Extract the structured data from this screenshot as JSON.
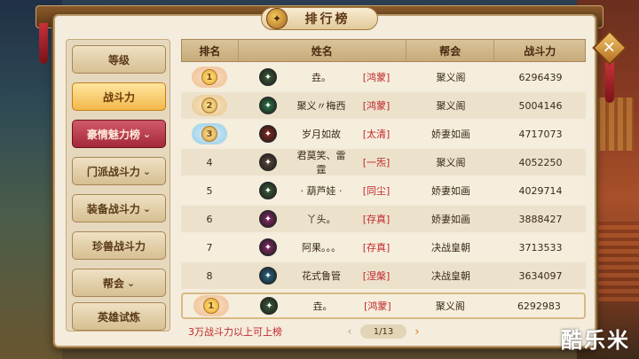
{
  "window": {
    "title": "排行榜"
  },
  "close": {
    "glyph": "✕"
  },
  "sidebar": {
    "items": [
      {
        "label": "等级",
        "chevron": ""
      },
      {
        "label": "战斗力",
        "chevron": ""
      },
      {
        "label": "豪情魅力榜",
        "chevron": "⌄"
      },
      {
        "label": "门派战斗力",
        "chevron": "⌄"
      },
      {
        "label": "装备战斗力",
        "chevron": "⌄"
      },
      {
        "label": "珍兽战斗力",
        "chevron": ""
      },
      {
        "label": "帮会",
        "chevron": "⌄"
      },
      {
        "label": "英雄试炼",
        "chevron": ""
      }
    ]
  },
  "table": {
    "headers": {
      "rank": "排名",
      "name": "姓名",
      "guild": "帮会",
      "power": "战斗力"
    },
    "rows": [
      {
        "rank": "1",
        "medal": "gold",
        "icon_color": "#3b5f3a",
        "name": "垚。",
        "server": "[鸿蒙]",
        "guild": "聚义阁",
        "power": "6296439"
      },
      {
        "rank": "2",
        "medal": "silver",
        "icon_color": "#2f7a4a",
        "name": "聚义〃梅西",
        "server": "[鸿蒙]",
        "guild": "聚义阁",
        "power": "5004146"
      },
      {
        "rank": "3",
        "medal": "bronze",
        "icon_color": "#8a2a24",
        "name": "岁月如故",
        "server": "[太清]",
        "guild": "娇妻如画",
        "power": "4717073"
      },
      {
        "rank": "4",
        "medal": "",
        "icon_color": "#5a4a3a",
        "name": "君莫笑、雷霆",
        "server": "[一炁]",
        "guild": "聚义阁",
        "power": "4052250"
      },
      {
        "rank": "5",
        "medal": "",
        "icon_color": "#3b5f3a",
        "name": "· 葫芦娃 ·",
        "server": "[同尘]",
        "guild": "娇妻如画",
        "power": "4029714"
      },
      {
        "rank": "6",
        "medal": "",
        "icon_color": "#8a2a6a",
        "name": "丫头。",
        "server": "[存真]",
        "guild": "娇妻如画",
        "power": "3888427"
      },
      {
        "rank": "7",
        "medal": "",
        "icon_color": "#8a2a6a",
        "name": "阿果。。。",
        "server": "[存真]",
        "guild": "决战皇朝",
        "power": "3713533"
      },
      {
        "rank": "8",
        "medal": "",
        "icon_color": "#2a6a8a",
        "name": "花式鲁管",
        "server": "[涅槃]",
        "guild": "决战皇朝",
        "power": "3634097"
      }
    ],
    "mine": {
      "rank": "1",
      "medal": "gold",
      "icon_color": "#3b5f3a",
      "name": "垚。",
      "server": "[鸿蒙]",
      "guild": "聚义阁",
      "power": "6292983"
    }
  },
  "footer": {
    "note": "3万战斗力以上可上榜",
    "page": "1/13",
    "prev": "‹",
    "next": "›"
  },
  "watermark": "酷乐米"
}
